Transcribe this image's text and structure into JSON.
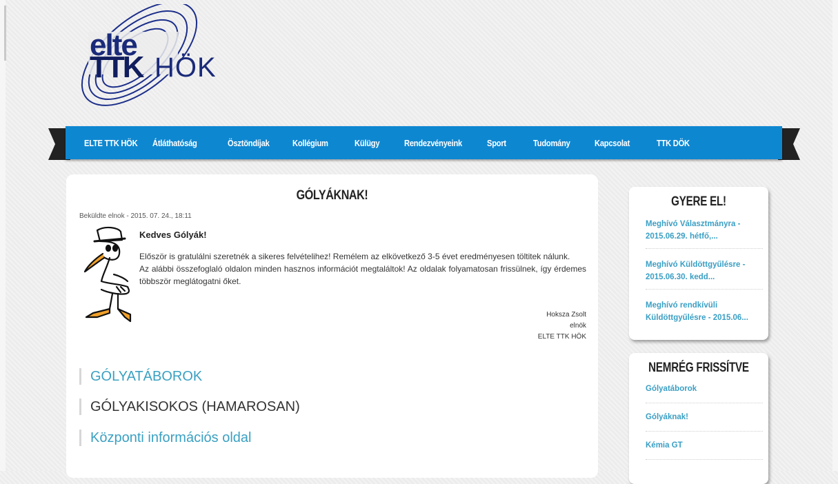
{
  "logo": {
    "elte": "elte",
    "ttk": "TTK",
    "hok": "HÖK"
  },
  "nav": {
    "items": [
      "ELTE TTK HÖK",
      "Átláthatóság",
      "Ösztöndíjak",
      "Kollégium",
      "Külügy",
      "Rendezvényeink",
      "Sport",
      "Tudomány",
      "Kapcsolat",
      "TTK DÖK"
    ]
  },
  "article": {
    "title": "GÓLYÁKNAK!",
    "submitted": "Beküldte elnok - 2015. 07. 24., 18:11",
    "greeting": "Kedves Gólyák!",
    "paragraph1": "Először is gratulálni szeretnék a sikeres felvételihez! Remélem az elkövetkező 3-5 évet eredményesen töltitek nálunk.",
    "paragraph2": "Az alábbi összefoglaló oldalon minden hasznos információt megtaláltok! Az oldalak folyamatosan frissülnek, így érdemes többször meglátogatni őket.",
    "signature": {
      "name": "Hoksza Zsolt",
      "role": "elnök",
      "org": "ELTE TTK HÖK"
    },
    "links": [
      "GÓLYATÁBOROK",
      "GÓLYAKISOKOS (HAMAROSAN)",
      "Központi információs oldal"
    ]
  },
  "sidebar": {
    "events": {
      "title": "GYERE EL!",
      "items": [
        "Meghívó Választmányra - 2015.06.29. hétfő,...",
        "Meghívó Küldöttgyűlésre - 2015.06.30. kedd...",
        "Meghívó rendkívüli Küldöttgyűlésre - 2015.06..."
      ]
    },
    "recent": {
      "title": "NEMRÉG FRISSÍTVE",
      "items": [
        "Gólyatáborok",
        "Gólyáknak!",
        "Kémia GT"
      ]
    }
  }
}
